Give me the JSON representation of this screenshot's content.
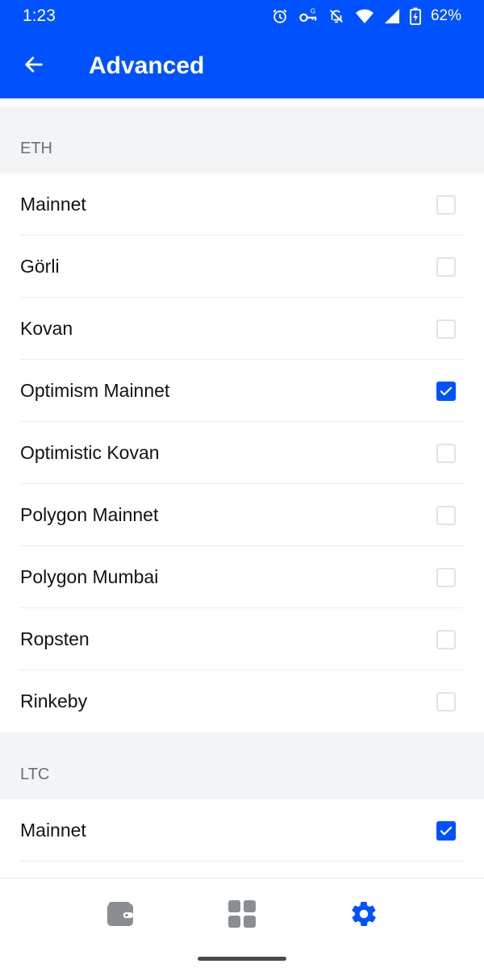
{
  "status_bar": {
    "time": "1:23",
    "battery": "62%",
    "icons": [
      "alarm-icon",
      "vpn-key-icon",
      "notifications-off-icon",
      "wifi-icon",
      "signal-icon",
      "battery-charging-icon"
    ]
  },
  "app_bar": {
    "title": "Advanced",
    "back_icon": "arrow-back-icon"
  },
  "sections": {
    "eth": {
      "label": "ETH",
      "items": [
        {
          "label": "Mainnet",
          "checked": false
        },
        {
          "label": "Görli",
          "checked": false
        },
        {
          "label": "Kovan",
          "checked": false
        },
        {
          "label": "Optimism Mainnet",
          "checked": true
        },
        {
          "label": "Optimistic Kovan",
          "checked": false
        },
        {
          "label": "Polygon Mainnet",
          "checked": false
        },
        {
          "label": "Polygon Mumbai",
          "checked": false
        },
        {
          "label": "Ropsten",
          "checked": false
        },
        {
          "label": "Rinkeby",
          "checked": false
        }
      ]
    },
    "ltc": {
      "label": "LTC",
      "items": [
        {
          "label": "Mainnet",
          "checked": true
        },
        {
          "label": "",
          "checked": false
        }
      ]
    }
  },
  "bottom_nav": {
    "items": [
      {
        "icon": "wallet-icon",
        "active": false
      },
      {
        "icon": "apps-grid-icon",
        "active": false
      },
      {
        "icon": "settings-gear-icon",
        "active": true
      }
    ]
  },
  "colors": {
    "brand": "#0052ff",
    "inactive_icon": "#8a8d92",
    "section_bg": "#f3f4f5",
    "section_text": "#6b6f76"
  }
}
